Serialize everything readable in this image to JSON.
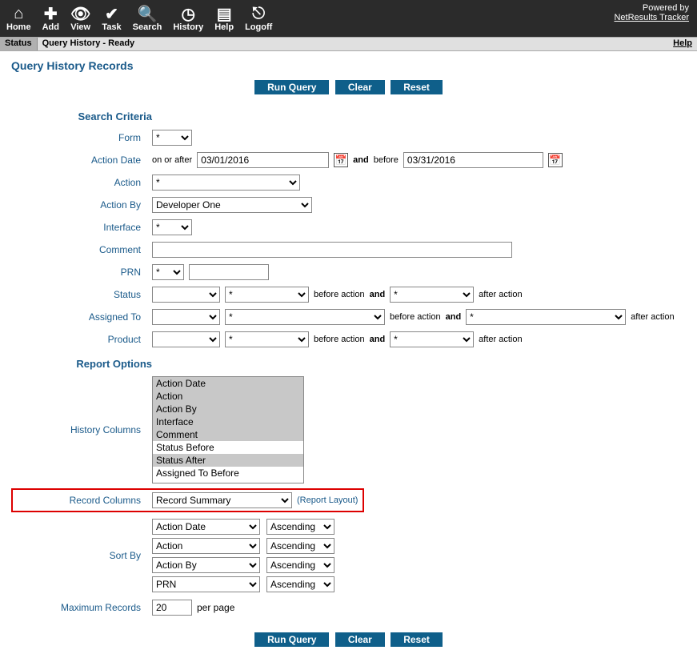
{
  "toolbar": {
    "items": [
      {
        "label": "Home"
      },
      {
        "label": "Add"
      },
      {
        "label": "View"
      },
      {
        "label": "Task"
      },
      {
        "label": "Search"
      },
      {
        "label": "History"
      },
      {
        "label": "Help"
      },
      {
        "label": "Logoff"
      }
    ],
    "powered_by": "Powered by",
    "product_link": "NetResults Tracker"
  },
  "status_bar": {
    "chip": "Status",
    "text": "Query History - Ready",
    "help": "Help"
  },
  "page_title": "Query History Records",
  "buttons": {
    "run_query": "Run Query",
    "clear": "Clear",
    "reset": "Reset"
  },
  "search_criteria": {
    "heading": "Search Criteria",
    "labels": {
      "form": "Form",
      "action_date": "Action Date",
      "action": "Action",
      "action_by": "Action By",
      "interface": "Interface",
      "comment": "Comment",
      "prn": "PRN",
      "status": "Status",
      "assigned_to": "Assigned To",
      "product": "Product"
    },
    "form_value": "*",
    "action_date": {
      "on_or_after": "on or after",
      "date1": "03/01/2016",
      "and": "and",
      "before": "before",
      "date2": "03/31/2016"
    },
    "action_value": "*",
    "action_by_value": "Developer One",
    "interface_value": "*",
    "comment_value": "",
    "prn": {
      "op": "*",
      "value": ""
    },
    "status": {
      "before_sel": "",
      "before_val": "*",
      "before_txt": "before action",
      "and": "and",
      "after_val": "*",
      "after_txt": "after action"
    },
    "assigned_to": {
      "before_sel": "",
      "before_val": "*",
      "before_txt": "before action",
      "and": "and",
      "after_val": "*",
      "after_txt": "after action"
    },
    "product": {
      "before_sel": "",
      "before_val": "*",
      "before_txt": "before action",
      "and": "and",
      "after_val": "*",
      "after_txt": "after action"
    }
  },
  "report_options": {
    "heading": "Report Options",
    "labels": {
      "history_columns": "History Columns",
      "record_columns": "Record Columns",
      "sort_by": "Sort By",
      "maximum_records": "Maximum Records"
    },
    "history_columns": {
      "options": [
        "Action Date",
        "Action",
        "Action By",
        "Interface",
        "Comment",
        "Status Before",
        "Status After",
        "Assigned To Before"
      ],
      "selected": [
        "Action Date",
        "Action",
        "Action By",
        "Interface",
        "Comment",
        "Status After"
      ]
    },
    "record_columns": {
      "value": "Record Summary",
      "layout_link": "(Report Layout)"
    },
    "sort_by": [
      {
        "field": "Action Date",
        "dir": "Ascending"
      },
      {
        "field": "Action",
        "dir": "Ascending"
      },
      {
        "field": "Action By",
        "dir": "Ascending"
      },
      {
        "field": "PRN",
        "dir": "Ascending"
      }
    ],
    "max_records": "20",
    "per_page": "per page"
  }
}
